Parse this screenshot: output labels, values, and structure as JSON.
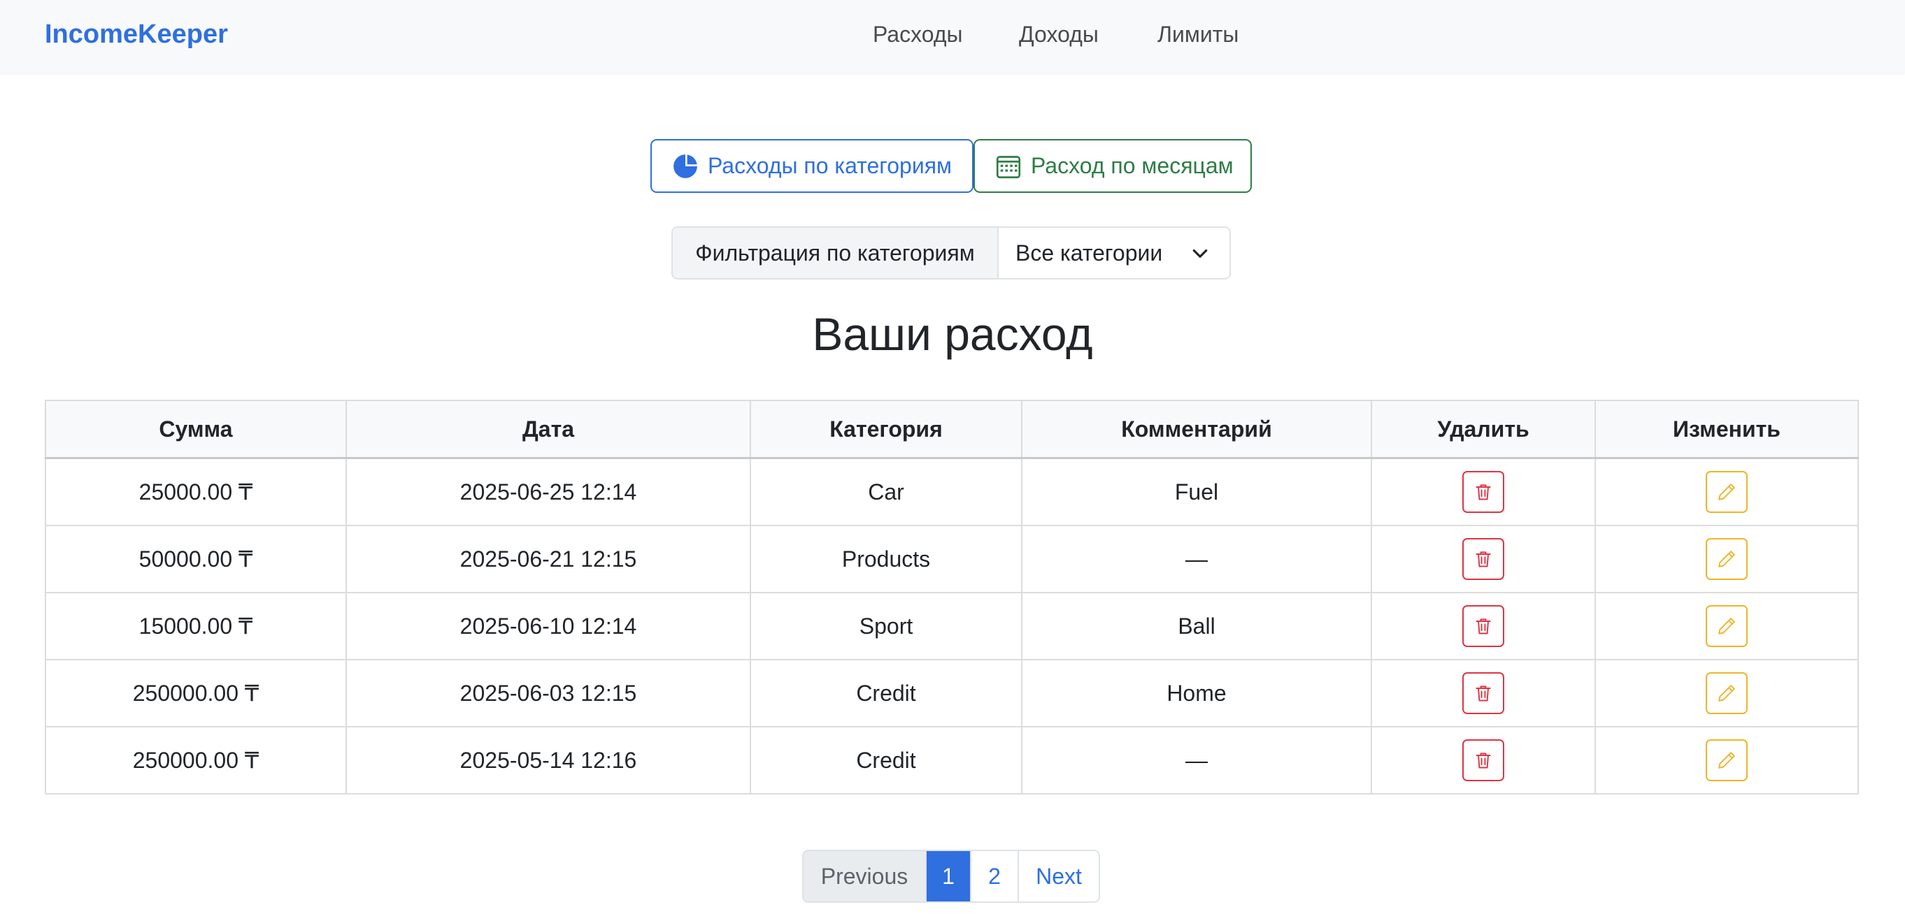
{
  "navbar": {
    "brand": "IncomeKeeper",
    "links": [
      "Расходы",
      "Доходы",
      "Лимиты"
    ]
  },
  "actions": {
    "by_category": {
      "label": "Расходы по категориям",
      "icon": "pie-chart-icon"
    },
    "by_month": {
      "label": "Расход по месяцам",
      "icon": "calendar-icon"
    }
  },
  "filter": {
    "label": "Фильтрация по категориям",
    "selected": "Все категории"
  },
  "page_title": "Ваши расход",
  "table": {
    "headers": [
      "Сумма",
      "Дата",
      "Категория",
      "Комментарий",
      "Удалить",
      "Изменить"
    ],
    "rows": [
      {
        "amount": "25000.00 ₸",
        "date": "2025-06-25 12:14",
        "category": "Car",
        "comment": "Fuel"
      },
      {
        "amount": "50000.00 ₸",
        "date": "2025-06-21 12:15",
        "category": "Products",
        "comment": "—"
      },
      {
        "amount": "15000.00 ₸",
        "date": "2025-06-10 12:14",
        "category": "Sport",
        "comment": "Ball"
      },
      {
        "amount": "250000.00 ₸",
        "date": "2025-06-03 12:15",
        "category": "Credit",
        "comment": "Home"
      },
      {
        "amount": "250000.00 ₸",
        "date": "2025-05-14 12:16",
        "category": "Credit",
        "comment": "—"
      }
    ]
  },
  "pagination": {
    "previous": "Previous",
    "pages": [
      "1",
      "2"
    ],
    "current": "1",
    "next": "Next"
  },
  "colors": {
    "primary": "#2f6fe0",
    "success": "#2e7d45",
    "danger": "#dc3545",
    "warning": "#f0b429"
  }
}
